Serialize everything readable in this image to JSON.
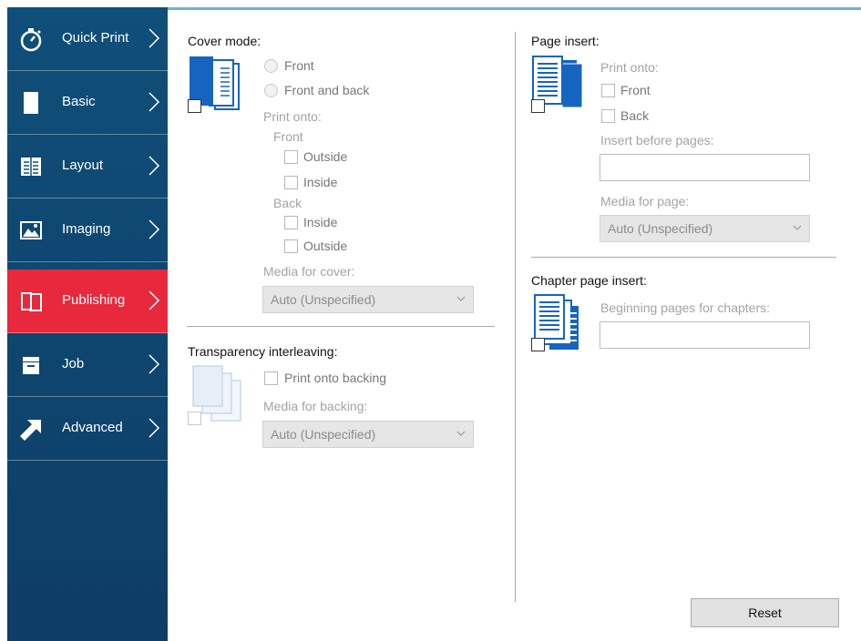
{
  "sidebar": {
    "items": [
      {
        "label": "Quick Print",
        "icon": "stopwatch-icon",
        "active": false
      },
      {
        "label": "Basic",
        "icon": "page-icon",
        "active": false
      },
      {
        "label": "Layout",
        "icon": "layout-icon",
        "active": false
      },
      {
        "label": "Imaging",
        "icon": "image-icon",
        "active": false
      },
      {
        "label": "Publishing",
        "icon": "publishing-icon",
        "active": true
      },
      {
        "label": "Job",
        "icon": "job-icon",
        "active": false
      },
      {
        "label": "Advanced",
        "icon": "arrow-icon",
        "active": false
      }
    ]
  },
  "cover_mode": {
    "title": "Cover mode:",
    "option_front": "Front",
    "option_front_and_back": "Front and back",
    "print_onto_label": "Print onto:",
    "front_label": "Front",
    "front_outside": "Outside",
    "front_inside": "Inside",
    "back_label": "Back",
    "back_inside": "Inside",
    "back_outside": "Outside",
    "media_label": "Media for cover:",
    "media_value": "Auto (Unspecified)"
  },
  "transparency": {
    "title": "Transparency interleaving:",
    "print_onto_backing": "Print onto backing",
    "media_label": "Media for backing:",
    "media_value": "Auto (Unspecified)"
  },
  "page_insert": {
    "title": "Page insert:",
    "print_onto_label": "Print onto:",
    "front": "Front",
    "back": "Back",
    "insert_before_label": "Insert before pages:",
    "insert_before_value": "",
    "media_label": "Media for page:",
    "media_value": "Auto (Unspecified)"
  },
  "chapter_insert": {
    "title": "Chapter page insert:",
    "beginning_label": "Beginning pages for chapters:",
    "beginning_value": ""
  },
  "footer": {
    "reset_label": "Reset"
  },
  "colors": {
    "sidebar_bg": "#0f4f79",
    "active_item": "#e8283c",
    "accent_line": "#6ab3d9",
    "icon_blue": "#1565c0"
  }
}
